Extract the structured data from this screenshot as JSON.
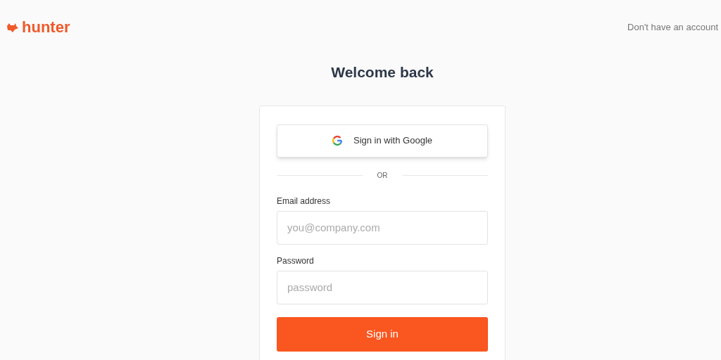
{
  "header": {
    "logo": "hunter",
    "signup_prompt": "Don't have an account"
  },
  "title": "Welcome back",
  "google_button": "Sign in with Google",
  "divider": "OR",
  "fields": [
    {
      "label": "Email address",
      "placeholder": "you@company.com"
    },
    {
      "label": "Password",
      "placeholder": "password"
    }
  ],
  "submit": "Sign in"
}
